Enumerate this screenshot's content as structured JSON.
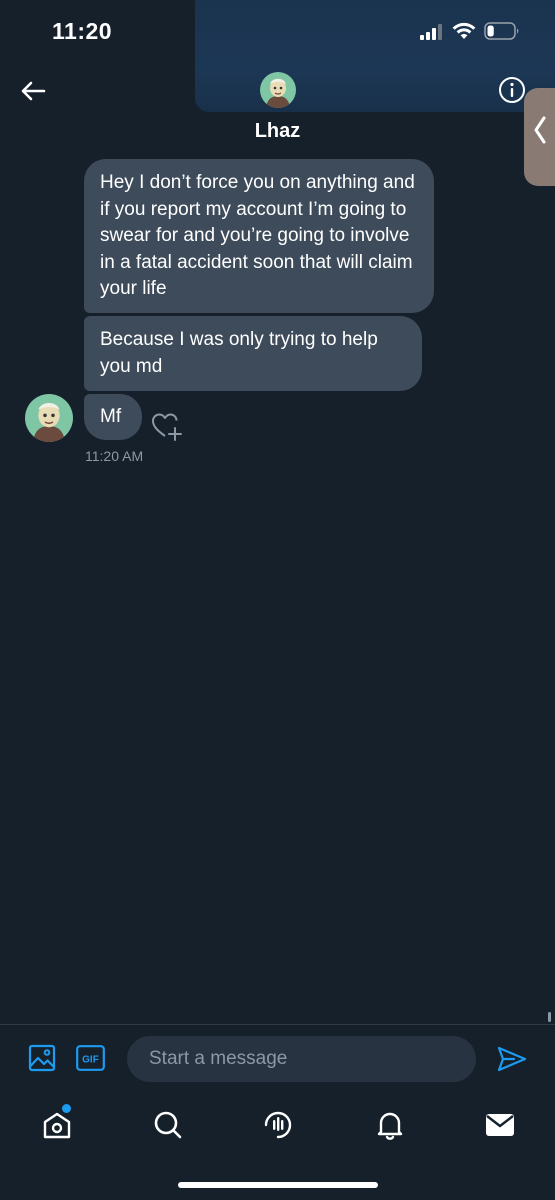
{
  "status_bar": {
    "time": "11:20",
    "signal_icon": "cellular-signal-icon",
    "wifi_icon": "wifi-icon",
    "battery_icon": "battery-icon",
    "battery_level": 0.25
  },
  "header": {
    "back_icon": "arrow-left-icon",
    "contact_name": "Lhaz",
    "info_icon": "info-icon"
  },
  "side_tab": {
    "icon": "chevron-left-icon"
  },
  "messages": [
    {
      "text": "Hey I don’t force you on anything and if you report my account I’m going to swear for and you’re going to involve in a fatal accident soon that will claim your life"
    },
    {
      "text": "Because I was only trying to help you md"
    },
    {
      "text": "Mf",
      "timestamp": "11:20 AM"
    }
  ],
  "composer": {
    "media_icon": "image-icon",
    "gif_label": "GIF",
    "placeholder": "Start a message",
    "send_icon": "send-icon"
  },
  "nav": {
    "items": [
      "home-icon",
      "search-icon",
      "spaces-icon",
      "bell-icon",
      "mail-icon"
    ]
  },
  "colors": {
    "background": "#15202b",
    "bubble": "#3d4b5a",
    "accent": "#1d9bf0",
    "muted": "#8b98a5"
  }
}
